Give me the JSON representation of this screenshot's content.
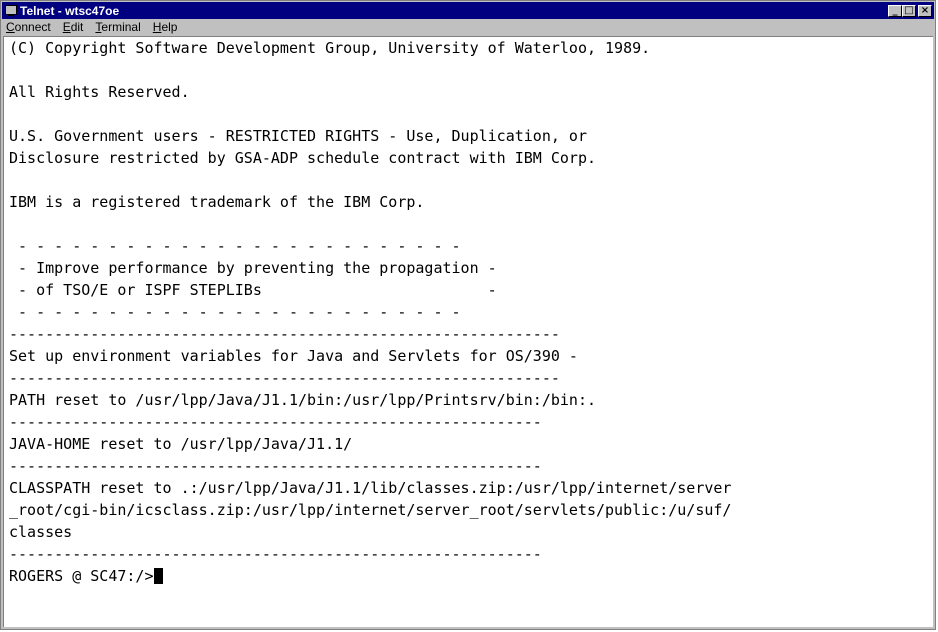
{
  "window": {
    "title": "Telnet - wtsc47oe",
    "buttons": {
      "minimize": "_",
      "maximize": "□",
      "close": "×"
    }
  },
  "menu": [
    {
      "prefix": "",
      "key": "C",
      "rest": "onnect"
    },
    {
      "prefix": "",
      "key": "E",
      "rest": "dit"
    },
    {
      "prefix": "",
      "key": "T",
      "rest": "erminal"
    },
    {
      "prefix": "",
      "key": "H",
      "rest": "elp"
    }
  ],
  "terminal": {
    "lines": [
      "(C) Copyright Software Development Group, University of Waterloo, 1989.",
      "",
      "All Rights Reserved.",
      "",
      "U.S. Government users - RESTRICTED RIGHTS - Use, Duplication, or",
      "Disclosure restricted by GSA-ADP schedule contract with IBM Corp.",
      "",
      "IBM is a registered trademark of the IBM Corp.",
      "",
      " - - - - - - - - - - - - - - - - - - - - - - - - -",
      " - Improve performance by preventing the propagation -",
      " - of TSO/E or ISPF STEPLIBs                         -",
      " - - - - - - - - - - - - - - - - - - - - - - - - -",
      "-------------------------------------------------------------",
      "Set up environment variables for Java and Servlets for OS/390 -",
      "-------------------------------------------------------------",
      "PATH reset to /usr/lpp/Java/J1.1/bin:/usr/lpp/Printsrv/bin:/bin:.",
      "-----------------------------------------------------------",
      "JAVA-HOME reset to /usr/lpp/Java/J1.1/",
      "-----------------------------------------------------------",
      "CLASSPATH reset to .:/usr/lpp/Java/J1.1/lib/classes.zip:/usr/lpp/internet/server",
      "_root/cgi-bin/icsclass.zip:/usr/lpp/internet/server_root/servlets/public:/u/suf/",
      "classes",
      "-----------------------------------------------------------"
    ],
    "prompt": "ROGERS @ SC47:/>"
  }
}
